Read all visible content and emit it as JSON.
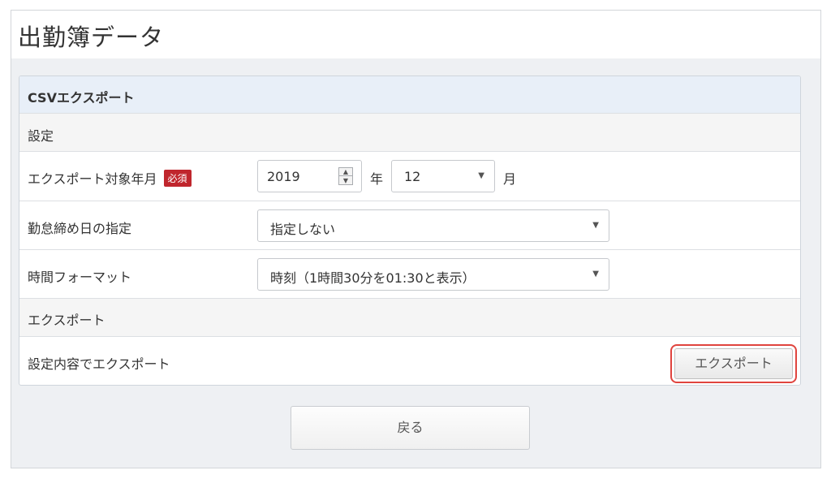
{
  "page": {
    "title": "出勤簿データ"
  },
  "panel": {
    "header": "CSVエクスポート",
    "settings_section": "設定",
    "target_month": {
      "label": "エクスポート対象年月",
      "required_badge": "必須",
      "year_value": "2019",
      "year_unit": "年",
      "month_value": "12",
      "month_unit": "月"
    },
    "closing_day": {
      "label": "勤怠締め日の指定",
      "value": "指定しない"
    },
    "time_format": {
      "label": "時間フォーマット",
      "value": "時刻（1時間30分を01:30と表示）"
    },
    "export_section": "エクスポート",
    "export_row": {
      "label": "設定内容でエクスポート",
      "button": "エクスポート"
    }
  },
  "footer": {
    "back_button": "戻る"
  },
  "colors": {
    "required": "#c0262d",
    "highlight": "#e0443e",
    "header_bg": "#e8eff8"
  },
  "icons": {
    "spinner": "updown-spinner-icon",
    "caret": "caret-down-icon"
  }
}
